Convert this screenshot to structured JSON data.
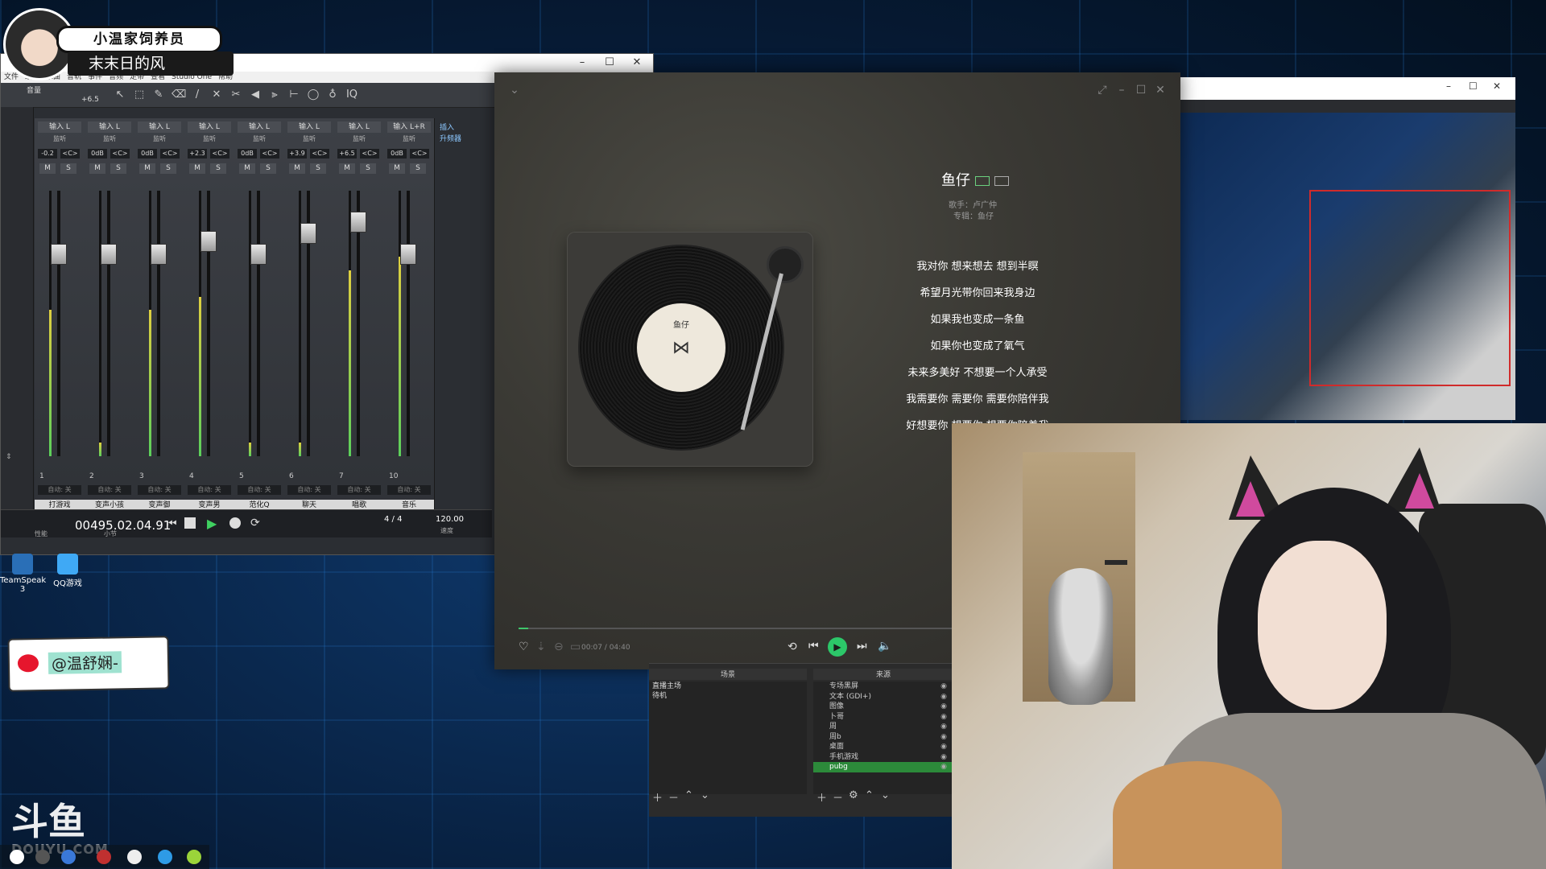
{
  "banner": {
    "title": "小温家饲养员",
    "subtitle": "末末日的风"
  },
  "studio": {
    "menu": [
      "文件",
      "编辑",
      "乐曲",
      "音轨",
      "事件",
      "音频",
      "走带",
      "查看",
      "Studio One",
      "帮助"
    ],
    "track_label": "音量",
    "volume_value": "+6.5",
    "channels": [
      {
        "input": "输入 L",
        "monitor": "监听",
        "db": "-0.2",
        "num": "1",
        "name": "打游戏",
        "level": 0.55,
        "fader": 0.2
      },
      {
        "input": "输入 L",
        "monitor": "监听",
        "db": "0dB",
        "num": "2",
        "name": "变声小孩",
        "level": 0.05,
        "fader": 0.2
      },
      {
        "input": "输入 L",
        "monitor": "监听",
        "db": "0dB",
        "num": "3",
        "name": "变声御",
        "level": 0.55,
        "fader": 0.2
      },
      {
        "input": "输入 L",
        "monitor": "监听",
        "db": "+2.3",
        "num": "4",
        "name": "变声男",
        "level": 0.6,
        "fader": 0.15
      },
      {
        "input": "输入 L",
        "monitor": "监听",
        "db": "0dB",
        "num": "5",
        "name": "范化Q",
        "level": 0.05,
        "fader": 0.2
      },
      {
        "input": "输入 L",
        "monitor": "监听",
        "db": "+3.9",
        "num": "6",
        "name": "聊天",
        "level": 0.05,
        "fader": 0.12
      },
      {
        "input": "输入 L",
        "monitor": "监听",
        "db": "+6.5",
        "num": "7",
        "name": "唱歌",
        "level": 0.7,
        "fader": 0.08
      },
      {
        "input": "输入 L+R",
        "monitor": "监听",
        "db": "0dB",
        "num": "10",
        "name": "音乐",
        "level": 0.75,
        "fader": 0.2
      }
    ],
    "auto_label": "自动: 关",
    "insert_label": "插入",
    "insert_sub": "升频器",
    "transport": {
      "time": "00495.02.04.91",
      "unit": "小节",
      "signature": "4 / 4",
      "tempo": "120.00",
      "tempo_label": "速度",
      "perf_label": "性能"
    }
  },
  "desktop_icons": [
    {
      "label": "TeamSpeak 3",
      "color": "#2a6fb7"
    },
    {
      "label": "QQ游戏",
      "color": "#3fa9f5"
    }
  ],
  "weibo": {
    "handle": "@温舒娴-"
  },
  "douyu": {
    "logo_text": "斗鱼",
    "domain": "DOUYU.COM"
  },
  "player": {
    "song_title": "鱼仔",
    "artist": "歌手：卢广仲",
    "album": "专辑：鱼仔",
    "lyrics": [
      {
        "text": "我对你 想来想去 想到半瞑",
        "dim": false
      },
      {
        "text": "希望月光带你回来我身边",
        "dim": false
      },
      {
        "text": "如果我也变成一条鱼",
        "dim": false
      },
      {
        "text": "如果你也变成了氧气",
        "dim": false
      },
      {
        "text": "未来多美好 不想要一个人承受",
        "dim": false
      },
      {
        "text": "我需要你 需要你 需要你陪伴我",
        "dim": false
      },
      {
        "text": "好想要你 想要你 想要你陪着我",
        "dim": false
      }
    ],
    "time": "00:07 / 04:40",
    "progress": 0.015,
    "record_label": "鱼仔"
  },
  "obs": {
    "scenes_header": "场景",
    "sources_header": "来源",
    "scenes": [
      "直播主场",
      "待机"
    ],
    "sources": [
      {
        "name": "专场黑屏",
        "sel": false
      },
      {
        "name": "文本 (GDI+)",
        "sel": false
      },
      {
        "name": "图像",
        "sel": false
      },
      {
        "name": "卜哥",
        "sel": false
      },
      {
        "name": "周",
        "sel": false
      },
      {
        "name": "周b",
        "sel": false
      },
      {
        "name": "桌面",
        "sel": false
      },
      {
        "name": "手机游戏",
        "sel": false
      },
      {
        "name": "pubg",
        "sel": true
      }
    ]
  },
  "colors": {
    "accent_green": "#2cc769",
    "studio_bg": "#2b2e33"
  }
}
